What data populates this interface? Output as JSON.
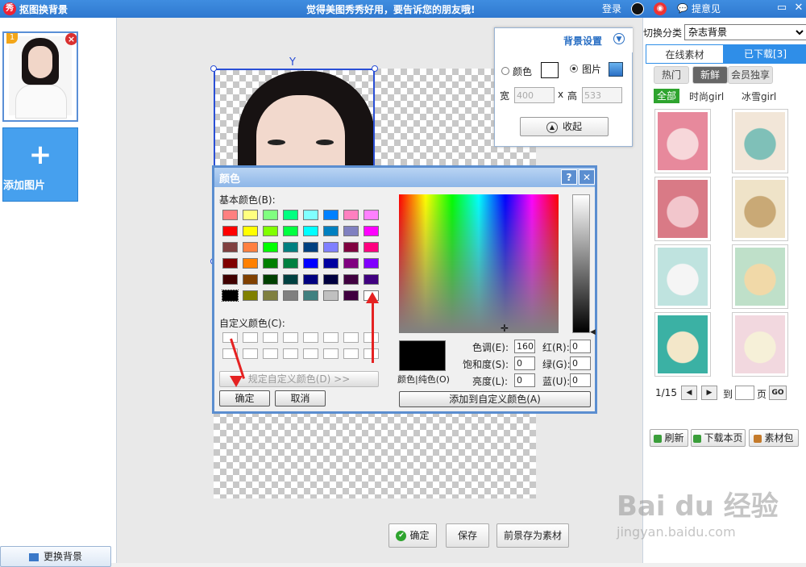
{
  "titlebar": {
    "app_icon": "秀",
    "app_title": "抠图换背景",
    "slogan": "觉得美图秀秀好用，要告诉您的朋友哦!",
    "login": "登录",
    "feedback": "提意见",
    "icons": [
      "qq-icon",
      "weibo-icon",
      "feedback-icon",
      "maximize-icon",
      "close-icon"
    ]
  },
  "left": {
    "thumb_number": "1",
    "add_image_label": "添加图片",
    "change_bg_label": "更换背景"
  },
  "bg_settings": {
    "title": "背景设置",
    "color_label": "颜色",
    "image_label": "图片",
    "width_label": "宽",
    "width_value": "400",
    "x_sep": "x",
    "height_label": "高",
    "height_value": "533",
    "collapse_label": "收起",
    "selected_mode": "图片"
  },
  "color_dialog": {
    "title": "颜色",
    "help": "?",
    "close": "✕",
    "basic_colors_label": "基本颜色(B):",
    "custom_colors_label": "自定义颜色(C):",
    "define_custom_label": "规定自定义颜色(D) >>",
    "ok_label": "确定",
    "cancel_label": "取消",
    "color_solid_label": "颜色|纯色(O)",
    "hue_label": "色调(E):",
    "hue": "160",
    "sat_label": "饱和度(S):",
    "sat": "0",
    "lum_label": "亮度(L):",
    "lum": "0",
    "red_label": "红(R):",
    "red": "0",
    "green_label": "绿(G):",
    "green": "0",
    "blue_label": "蓝(U):",
    "blue": "0",
    "add_custom_label": "添加到自定义颜色(A)",
    "basic_colors": [
      "#ff8080",
      "#ffff80",
      "#80ff80",
      "#00ff80",
      "#80ffff",
      "#0080ff",
      "#ff80c0",
      "#ff80ff",
      "#ff0000",
      "#ffff00",
      "#80ff00",
      "#00ff40",
      "#00ffff",
      "#0080c0",
      "#8080c0",
      "#ff00ff",
      "#804040",
      "#ff8040",
      "#00ff00",
      "#008080",
      "#004080",
      "#8080ff",
      "#800040",
      "#ff0080",
      "#800000",
      "#ff8000",
      "#008000",
      "#008040",
      "#0000ff",
      "#0000a0",
      "#800080",
      "#8000ff",
      "#400000",
      "#804000",
      "#004000",
      "#004040",
      "#000080",
      "#000040",
      "#400040",
      "#400080",
      "#000000",
      "#808000",
      "#808040",
      "#808080",
      "#408080",
      "#c0c0c0",
      "#400040",
      "#ffffff"
    ]
  },
  "right": {
    "category_label": "切换分类",
    "category_value": "杂志背景",
    "tab_online": "在线素材",
    "tab_downloaded": "已下载[3]",
    "subtabs": [
      "热门",
      "新鲜",
      "会员独享"
    ],
    "active_subtab": "新鲜",
    "cat_all": "全部",
    "cats": [
      "时尚girl",
      "冰雪girl"
    ],
    "page_current": "1/15",
    "page_to_label": "到",
    "page_unit": "页",
    "go_label": "GO",
    "refresh_label": "刷新",
    "download_page_label": "下载本页",
    "material_pack_label": "素材包",
    "cards": [
      {
        "bg": "#e7899c",
        "accent": "#f7d7da"
      },
      {
        "bg": "#f2e6d8",
        "accent": "#7fc0b8"
      },
      {
        "bg": "#d97a86",
        "accent": "#f2c6cc"
      },
      {
        "bg": "#efe3c8",
        "accent": "#c9a976"
      },
      {
        "bg": "#bfe3df",
        "accent": "#f5f5f5"
      },
      {
        "bg": "#bfe0c9",
        "accent": "#f1d9a8"
      },
      {
        "bg": "#3bb1a4",
        "accent": "#f3e7c9"
      },
      {
        "bg": "#f2d8df",
        "accent": "#f6f0d8"
      }
    ]
  },
  "bottom": {
    "ok_label": "确定",
    "save_label": "保存",
    "save_fg_label": "前景存为素材"
  },
  "watermark": {
    "text": "Bai du 经验",
    "url": "jingyan.baidu.com"
  }
}
